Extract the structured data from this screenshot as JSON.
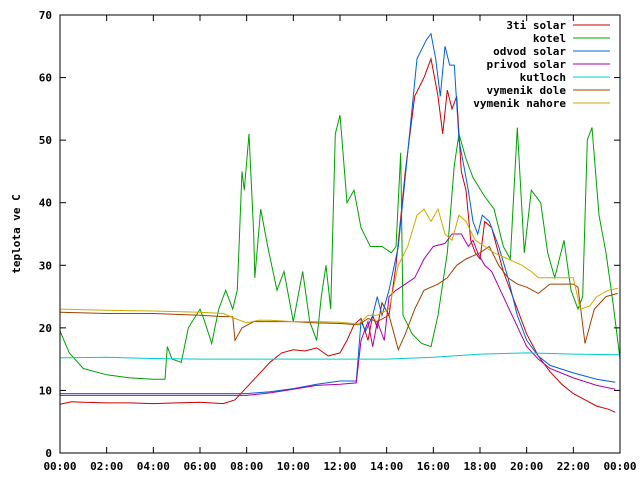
{
  "chart_data": {
    "type": "line",
    "title": "",
    "xlabel": "",
    "ylabel": "teplota ve C",
    "xlim": [
      0,
      24
    ],
    "ylim": [
      0,
      70
    ],
    "x_ticks": [
      "00:00",
      "02:00",
      "04:00",
      "06:00",
      "08:00",
      "10:00",
      "12:00",
      "14:00",
      "16:00",
      "18:00",
      "20:00",
      "22:00",
      "00:00"
    ],
    "y_ticks": [
      0,
      10,
      20,
      30,
      40,
      50,
      60,
      70
    ],
    "grid": false,
    "legend_position": "top-right",
    "series": [
      {
        "name": "3ti solar",
        "color": "#cc0000",
        "points": [
          [
            0,
            7.8
          ],
          [
            0.5,
            8.2
          ],
          [
            1,
            8.1
          ],
          [
            2,
            8.0
          ],
          [
            3,
            8.0
          ],
          [
            4,
            7.9
          ],
          [
            5,
            8.0
          ],
          [
            6,
            8.1
          ],
          [
            7,
            7.9
          ],
          [
            7.5,
            8.5
          ],
          [
            8,
            10.5
          ],
          [
            8.5,
            12.5
          ],
          [
            9,
            14.5
          ],
          [
            9.5,
            16
          ],
          [
            10,
            16.5
          ],
          [
            10.5,
            16.3
          ],
          [
            11,
            16.8
          ],
          [
            11.5,
            15.5
          ],
          [
            12,
            16.0
          ],
          [
            12.3,
            18
          ],
          [
            12.6,
            20.5
          ],
          [
            12.9,
            21.5
          ],
          [
            13.2,
            18
          ],
          [
            13.4,
            22
          ],
          [
            13.6,
            20
          ],
          [
            13.8,
            24
          ],
          [
            14.1,
            22
          ],
          [
            14.4,
            30
          ],
          [
            14.8,
            45
          ],
          [
            15.2,
            57
          ],
          [
            15.6,
            60
          ],
          [
            15.9,
            63
          ],
          [
            16.2,
            57
          ],
          [
            16.4,
            51
          ],
          [
            16.6,
            58
          ],
          [
            16.8,
            55
          ],
          [
            17.0,
            57
          ],
          [
            17.2,
            45
          ],
          [
            17.4,
            42
          ],
          [
            17.6,
            34
          ],
          [
            17.8,
            32
          ],
          [
            18.0,
            31
          ],
          [
            18.2,
            37
          ],
          [
            18.5,
            36
          ],
          [
            19.0,
            29
          ],
          [
            19.5,
            24
          ],
          [
            20,
            19
          ],
          [
            20.5,
            15.5
          ],
          [
            21,
            13
          ],
          [
            21.5,
            11
          ],
          [
            22,
            9.5
          ],
          [
            22.5,
            8.5
          ],
          [
            23,
            7.5
          ],
          [
            23.5,
            7.0
          ],
          [
            23.8,
            6.5
          ]
        ]
      },
      {
        "name": "kotel",
        "color": "#00a000",
        "points": [
          [
            0,
            19.5
          ],
          [
            0.4,
            16
          ],
          [
            1,
            13.5
          ],
          [
            2,
            12.5
          ],
          [
            3,
            12
          ],
          [
            4,
            11.8
          ],
          [
            4.5,
            11.8
          ],
          [
            4.6,
            17
          ],
          [
            4.8,
            15
          ],
          [
            5.2,
            14.5
          ],
          [
            5.5,
            20
          ],
          [
            6,
            23
          ],
          [
            6.2,
            21
          ],
          [
            6.5,
            17.5
          ],
          [
            6.8,
            23
          ],
          [
            7.1,
            26
          ],
          [
            7.4,
            23
          ],
          [
            7.6,
            26
          ],
          [
            7.8,
            45
          ],
          [
            7.9,
            42
          ],
          [
            8.1,
            51
          ],
          [
            8.3,
            35
          ],
          [
            8.35,
            28
          ],
          [
            8.6,
            39
          ],
          [
            8.9,
            33
          ],
          [
            9.3,
            26
          ],
          [
            9.6,
            29
          ],
          [
            10,
            21
          ],
          [
            10.4,
            29
          ],
          [
            10.7,
            21
          ],
          [
            11,
            18
          ],
          [
            11.2,
            25
          ],
          [
            11.4,
            30
          ],
          [
            11.6,
            23
          ],
          [
            11.8,
            51
          ],
          [
            12,
            54
          ],
          [
            12.3,
            40
          ],
          [
            12.6,
            42
          ],
          [
            12.9,
            36
          ],
          [
            13.3,
            33
          ],
          [
            13.8,
            33
          ],
          [
            14.2,
            32
          ],
          [
            14.4,
            33
          ],
          [
            14.6,
            48
          ],
          [
            14.7,
            22
          ],
          [
            15.1,
            19
          ],
          [
            15.5,
            17.5
          ],
          [
            15.9,
            17
          ],
          [
            16.2,
            22
          ],
          [
            16.6,
            32
          ],
          [
            16.9,
            46
          ],
          [
            17.1,
            51
          ],
          [
            17.4,
            47
          ],
          [
            17.7,
            44
          ],
          [
            18.2,
            41
          ],
          [
            18.6,
            39
          ],
          [
            19,
            33
          ],
          [
            19.3,
            31
          ],
          [
            19.6,
            52
          ],
          [
            19.9,
            32
          ],
          [
            20.2,
            42
          ],
          [
            20.6,
            40
          ],
          [
            20.9,
            32
          ],
          [
            21.2,
            28
          ],
          [
            21.6,
            34
          ],
          [
            21.9,
            26
          ],
          [
            22.2,
            23
          ],
          [
            22.4,
            25
          ],
          [
            22.6,
            50
          ],
          [
            22.8,
            52
          ],
          [
            23.1,
            38
          ],
          [
            23.4,
            32
          ],
          [
            23.7,
            24
          ],
          [
            24,
            15
          ]
        ]
      },
      {
        "name": "odvod solar",
        "color": "#0060dd",
        "points": [
          [
            0,
            9.5
          ],
          [
            1,
            9.5
          ],
          [
            2,
            9.5
          ],
          [
            3,
            9.5
          ],
          [
            4,
            9.5
          ],
          [
            5,
            9.5
          ],
          [
            6,
            9.5
          ],
          [
            7,
            9.5
          ],
          [
            8,
            9.5
          ],
          [
            9,
            9.8
          ],
          [
            10,
            10.3
          ],
          [
            11,
            11
          ],
          [
            12,
            11.5
          ],
          [
            12.7,
            11.5
          ],
          [
            12.9,
            21
          ],
          [
            13.1,
            19.5
          ],
          [
            13.4,
            22
          ],
          [
            13.6,
            25
          ],
          [
            13.8,
            22
          ],
          [
            14.1,
            26
          ],
          [
            14.5,
            33
          ],
          [
            14.9,
            48
          ],
          [
            15.3,
            63
          ],
          [
            15.7,
            66
          ],
          [
            15.9,
            67
          ],
          [
            16.1,
            63
          ],
          [
            16.3,
            57
          ],
          [
            16.5,
            65
          ],
          [
            16.7,
            62
          ],
          [
            16.9,
            62
          ],
          [
            17.1,
            50
          ],
          [
            17.3,
            46
          ],
          [
            17.5,
            42
          ],
          [
            17.7,
            37
          ],
          [
            17.9,
            35
          ],
          [
            18.1,
            38
          ],
          [
            18.4,
            37
          ],
          [
            18.8,
            33
          ],
          [
            19.2,
            28
          ],
          [
            19.6,
            22
          ],
          [
            20,
            18
          ],
          [
            20.5,
            15.5
          ],
          [
            21,
            14
          ],
          [
            22,
            12.8
          ],
          [
            23,
            11.8
          ],
          [
            23.8,
            11.3
          ]
        ]
      },
      {
        "name": "privod solar",
        "color": "#aa00aa",
        "points": [
          [
            0,
            9.2
          ],
          [
            1,
            9.2
          ],
          [
            2,
            9.2
          ],
          [
            3,
            9.2
          ],
          [
            4,
            9.2
          ],
          [
            5,
            9.2
          ],
          [
            6,
            9.2
          ],
          [
            7,
            9.2
          ],
          [
            8,
            9.2
          ],
          [
            9,
            9.6
          ],
          [
            10,
            10.2
          ],
          [
            11,
            10.8
          ],
          [
            12,
            11.0
          ],
          [
            12.7,
            11.2
          ],
          [
            12.9,
            18
          ],
          [
            13.2,
            21
          ],
          [
            13.4,
            17
          ],
          [
            13.6,
            21
          ],
          [
            13.9,
            18
          ],
          [
            14.1,
            25
          ],
          [
            14.4,
            26
          ],
          [
            14.8,
            27
          ],
          [
            15.2,
            28
          ],
          [
            15.6,
            31
          ],
          [
            16,
            33
          ],
          [
            16.5,
            33.5
          ],
          [
            16.8,
            35
          ],
          [
            17.2,
            35
          ],
          [
            17.5,
            33
          ],
          [
            17.7,
            34
          ],
          [
            17.9,
            32
          ],
          [
            18.2,
            30
          ],
          [
            18.5,
            29
          ],
          [
            19,
            25
          ],
          [
            19.5,
            21
          ],
          [
            20,
            17
          ],
          [
            20.5,
            15
          ],
          [
            21,
            13.5
          ],
          [
            22,
            12
          ],
          [
            23,
            10.8
          ],
          [
            23.8,
            10.2
          ]
        ]
      },
      {
        "name": "kutloch",
        "color": "#00cccc",
        "points": [
          [
            0,
            15.2
          ],
          [
            2,
            15.3
          ],
          [
            4,
            15.1
          ],
          [
            6,
            15.0
          ],
          [
            8,
            15.0
          ],
          [
            10,
            15.0
          ],
          [
            12,
            15.0
          ],
          [
            14,
            15.0
          ],
          [
            16,
            15.3
          ],
          [
            18,
            15.8
          ],
          [
            20,
            16.0
          ],
          [
            22,
            15.8
          ],
          [
            24,
            15.7
          ]
        ]
      },
      {
        "name": "vymenik dole",
        "color": "#a04000",
        "points": [
          [
            0,
            22.5
          ],
          [
            2,
            22.3
          ],
          [
            4,
            22.3
          ],
          [
            6,
            22.0
          ],
          [
            7,
            21.8
          ],
          [
            7.4,
            21.8
          ],
          [
            7.5,
            18
          ],
          [
            7.8,
            20
          ],
          [
            8.3,
            21
          ],
          [
            9,
            21
          ],
          [
            10,
            21
          ],
          [
            11,
            20.8
          ],
          [
            12,
            20.7
          ],
          [
            12.8,
            20.5
          ],
          [
            13.2,
            21.5
          ],
          [
            13.6,
            21
          ],
          [
            14.1,
            22
          ],
          [
            14.5,
            16.5
          ],
          [
            14.8,
            19
          ],
          [
            15.2,
            23
          ],
          [
            15.6,
            26
          ],
          [
            16.2,
            27
          ],
          [
            16.6,
            28
          ],
          [
            17,
            30
          ],
          [
            17.4,
            31
          ],
          [
            18,
            32
          ],
          [
            18.4,
            33
          ],
          [
            18.8,
            30
          ],
          [
            19.2,
            28
          ],
          [
            19.6,
            27
          ],
          [
            20,
            26.5
          ],
          [
            20.5,
            25.5
          ],
          [
            21,
            27
          ],
          [
            22,
            27
          ],
          [
            22.2,
            26.5
          ],
          [
            22.5,
            17.5
          ],
          [
            22.9,
            23
          ],
          [
            23.4,
            25
          ],
          [
            23.9,
            25.5
          ]
        ]
      },
      {
        "name": "vymenik nahore",
        "color": "#ccaa00",
        "points": [
          [
            0,
            23
          ],
          [
            2,
            22.8
          ],
          [
            4,
            22.7
          ],
          [
            6,
            22.5
          ],
          [
            7,
            22.3
          ],
          [
            7.5,
            21.5
          ],
          [
            8,
            20.8
          ],
          [
            8.5,
            21.2
          ],
          [
            9,
            21.2
          ],
          [
            10,
            21
          ],
          [
            11,
            21
          ],
          [
            12,
            20.9
          ],
          [
            12.8,
            20.6
          ],
          [
            13.2,
            22
          ],
          [
            13.6,
            22
          ],
          [
            14.1,
            23
          ],
          [
            14.5,
            30
          ],
          [
            14.9,
            33
          ],
          [
            15.3,
            38
          ],
          [
            15.6,
            39
          ],
          [
            15.9,
            37
          ],
          [
            16.2,
            39
          ],
          [
            16.5,
            35
          ],
          [
            16.8,
            34
          ],
          [
            17.1,
            38
          ],
          [
            17.4,
            37
          ],
          [
            17.8,
            34
          ],
          [
            18.2,
            33
          ],
          [
            18.6,
            32
          ],
          [
            19.2,
            31
          ],
          [
            19.8,
            30
          ],
          [
            20.2,
            29
          ],
          [
            20.5,
            28
          ],
          [
            22,
            28
          ],
          [
            22.3,
            23
          ],
          [
            22.7,
            23.5
          ],
          [
            23,
            25
          ],
          [
            23.5,
            26
          ],
          [
            23.9,
            26.3
          ]
        ]
      }
    ]
  }
}
